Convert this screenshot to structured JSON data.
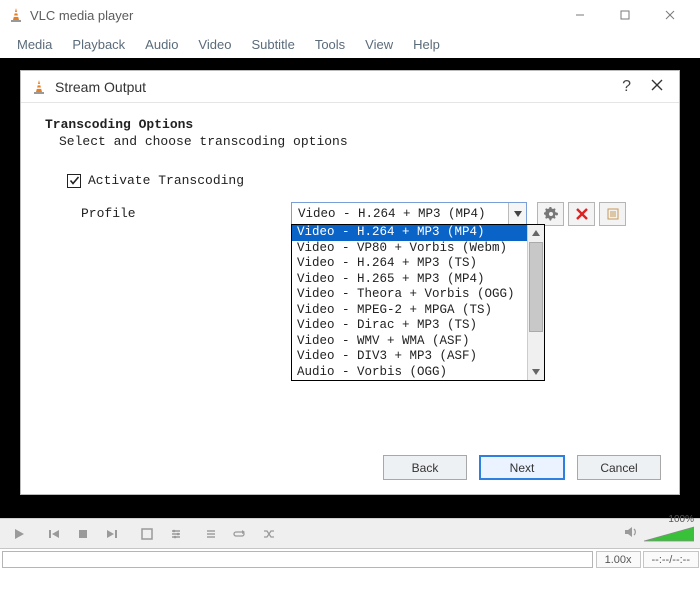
{
  "app": {
    "title": "VLC media player"
  },
  "menu": {
    "items": [
      "Media",
      "Playback",
      "Audio",
      "Video",
      "Subtitle",
      "Tools",
      "View",
      "Help"
    ]
  },
  "dialog": {
    "title": "Stream Output",
    "heading": "Transcoding Options",
    "subheading": "Select and choose transcoding options",
    "activate_label": "Activate Transcoding",
    "activate_checked": true,
    "profile_label": "Profile",
    "profile_selected": "Video - H.264 + MP3 (MP4)",
    "profile_options": [
      "Video - H.264 + MP3 (MP4)",
      "Video - VP80 + Vorbis (Webm)",
      "Video - H.264 + MP3 (TS)",
      "Video - H.265 + MP3 (MP4)",
      "Video - Theora + Vorbis (OGG)",
      "Video - MPEG-2 + MPGA (TS)",
      "Video - Dirac + MP3 (TS)",
      "Video - WMV + WMA (ASF)",
      "Video - DIV3 + MP3 (ASF)",
      "Audio - Vorbis (OGG)"
    ],
    "buttons": {
      "back": "Back",
      "next": "Next",
      "cancel": "Cancel"
    }
  },
  "controls": {
    "volume_pct": "100%"
  },
  "status": {
    "speed": "1.00x",
    "time": "--:--/--:--"
  }
}
